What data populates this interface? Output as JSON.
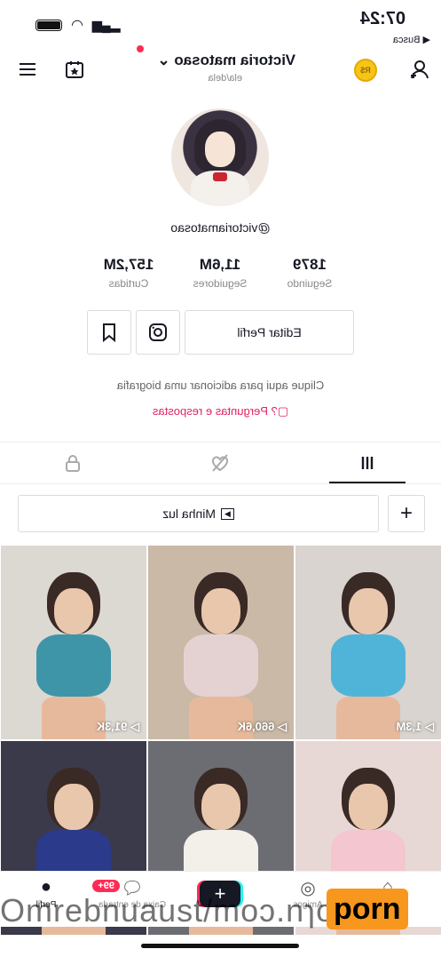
{
  "status": {
    "time": "07:24",
    "back_label": "◀ Busca"
  },
  "header": {
    "title": "Victoria matosao",
    "subtitle": "ela/dela",
    "coin_label": "R$"
  },
  "profile": {
    "handle": "@victoriamatosao",
    "stats": [
      {
        "value": "1879",
        "label": "Seguindo"
      },
      {
        "value": "11,6M",
        "label": "Seguidores"
      },
      {
        "value": "157,2M",
        "label": "Curtidas"
      }
    ],
    "edit_label": "Editar Perfil",
    "bio_placeholder": "Clique aqui para adicionar uma biografia",
    "qa_label": "Perguntas e respostas"
  },
  "tabs": [
    "videos",
    "liked",
    "private"
  ],
  "playlist": {
    "label": "Minha luz"
  },
  "videos": [
    {
      "views": "1,3M",
      "bg": "#d9d4cf",
      "accent": "#4fb4d8"
    },
    {
      "views": "660,6K",
      "bg": "#c9b9a6",
      "accent": "#e4d2d3"
    },
    {
      "views": "91,3K",
      "bg": "#dcd8d2",
      "accent": "#3e95a8"
    },
    {
      "views": "",
      "bg": "#e7d8d6",
      "accent": "#f4c6cf"
    },
    {
      "views": "",
      "bg": "#6b6d72",
      "accent": "#f3f0ea"
    },
    {
      "views": "",
      "bg": "#3a3a4a",
      "accent": "#2b3a8a"
    }
  ],
  "bottom_nav": [
    {
      "label": "Perfil"
    },
    {
      "label": "Caixa de entrada"
    },
    {
      "label": ""
    },
    {
      "label": "Amigos"
    },
    {
      "label": "Início"
    }
  ],
  "inbox_badge": "99+",
  "watermark": {
    "url": "Omrebnuaust/moɔ.nɿoq",
    "logo": "porn"
  }
}
